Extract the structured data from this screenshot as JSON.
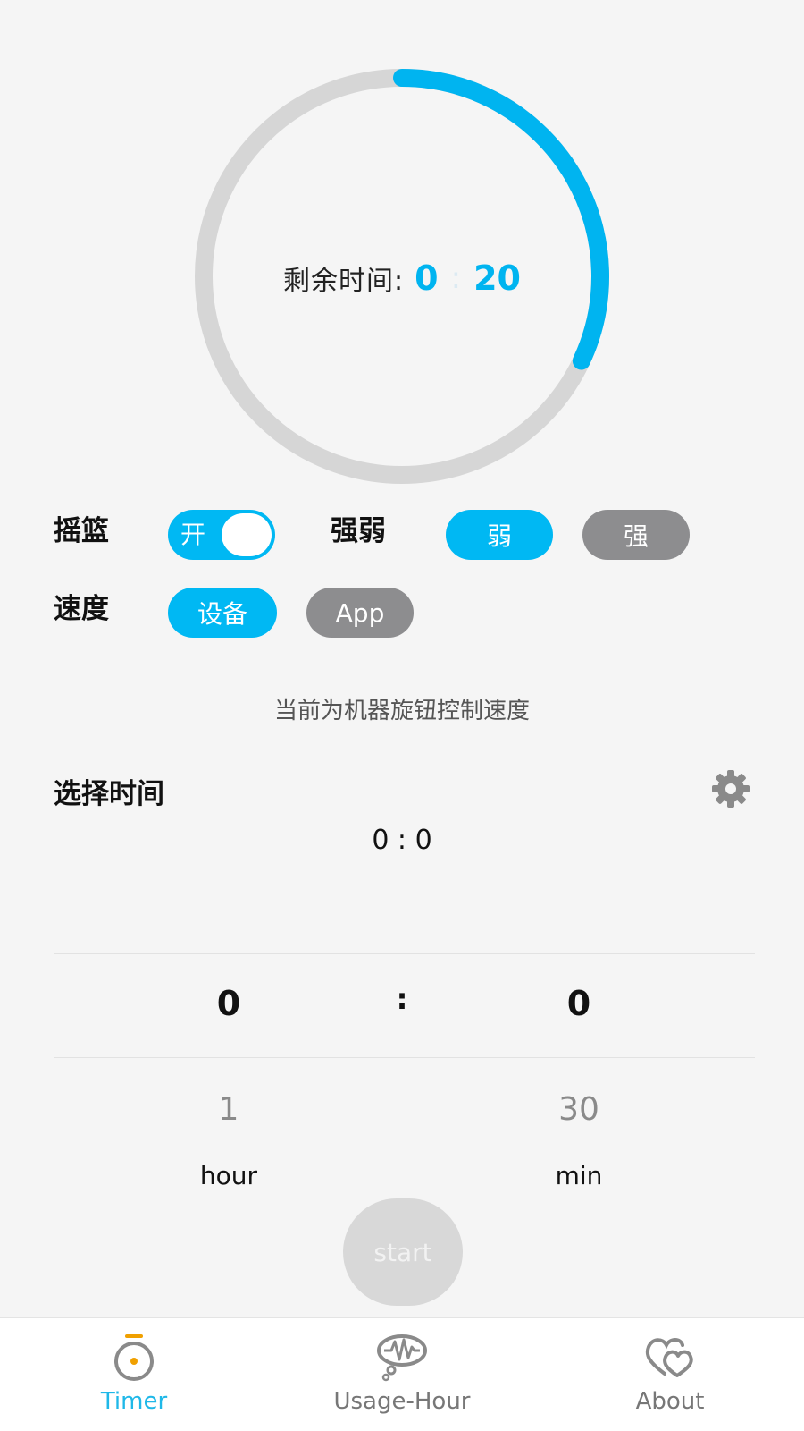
{
  "timer": {
    "remaining_label": "剩余时间:",
    "remaining_hours": "0",
    "separator": ":",
    "remaining_minutes": "20",
    "progress_fraction": 0.32,
    "accent_color": "#00b4f0",
    "track_color": "#d6d6d6"
  },
  "controls": {
    "cradle_label": "摇篮",
    "cradle_toggle_text": "开",
    "cradle_on": true,
    "strength_label": "强弱",
    "strength_weak": "弱",
    "strength_strong": "强",
    "strength_selected": "弱",
    "speed_label": "速度",
    "speed_device": "设备",
    "speed_app": "App",
    "speed_selected": "设备"
  },
  "hint_text": "当前为机器旋钮控制速度",
  "select_time": {
    "title": "选择时间",
    "settings_icon": "gear-icon",
    "display": "0 : 0"
  },
  "picker": {
    "hour_selected": "0",
    "colon": ":",
    "minute_selected": "0",
    "hour_next": "1",
    "minute_next": "30",
    "hour_unit": "hour",
    "minute_unit": "min"
  },
  "start_button": "start",
  "nav": {
    "active": "Timer",
    "items": [
      {
        "label": "Timer",
        "icon": "timer-icon"
      },
      {
        "label": "Usage-Hour",
        "icon": "usage-hour-icon"
      },
      {
        "label": "About",
        "icon": "about-icon"
      }
    ]
  },
  "colors": {
    "accent": "#00b8f3",
    "inactive_pill": "#8d8d8f",
    "nav_active": "#1fb8e8",
    "timer_icon_accent": "#f0a000"
  }
}
